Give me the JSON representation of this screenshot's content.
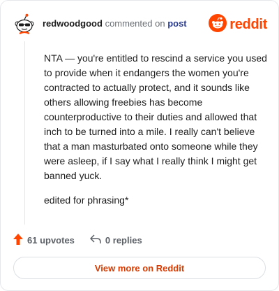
{
  "header": {
    "username": "redwoodgood",
    "action_text": "commented on",
    "post_link": "post",
    "logo_word": "reddit"
  },
  "comment": {
    "paragraphs": [
      "NTA — you're entitled to rescind a service you used to provide when it endangers the women you're contracted to actually protect, and it sounds like others allowing freebies has become counterproductive to their duties and allowed that inch to be turned into a mile. I really can't believe that a man masturbated onto someone while they were asleep, if I say what I really think I might get banned yuck.",
      "edited for phrasing*"
    ]
  },
  "actions": {
    "upvotes": "61 upvotes",
    "replies": "0 replies"
  },
  "footer": {
    "view_more": "View more on Reddit"
  },
  "colors": {
    "brand": "#ff4500",
    "link": "#2a3c8f",
    "view_more_text": "#d93a00"
  },
  "icons": [
    "avatar",
    "reddit-logo-icon",
    "upvote-icon",
    "reply-icon"
  ]
}
